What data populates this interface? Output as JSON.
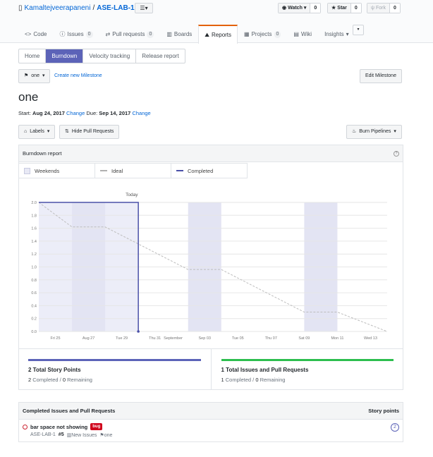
{
  "repo": {
    "owner": "Kamaltejveerapaneni",
    "sep": "/",
    "name": "ASE-LAB-1"
  },
  "social": {
    "watch": {
      "label": "Watch",
      "count": "0"
    },
    "star": {
      "label": "Star",
      "count": "0"
    },
    "fork": {
      "label": "Fork",
      "count": "0"
    }
  },
  "tabs": [
    {
      "label": "Code",
      "count": ""
    },
    {
      "label": "Issues",
      "count": "0"
    },
    {
      "label": "Pull requests",
      "count": "0"
    },
    {
      "label": "Boards",
      "count": ""
    },
    {
      "label": "Reports",
      "count": ""
    },
    {
      "label": "Projects",
      "count": "0"
    },
    {
      "label": "Wiki",
      "count": ""
    },
    {
      "label": "Insights",
      "count": ""
    }
  ],
  "subnav": [
    "Home",
    "Burndown",
    "Velocity tracking",
    "Release report"
  ],
  "milestone_select": "one",
  "create_milestone": "Create new Milestone",
  "edit_milestone": "Edit Milestone",
  "milestone": {
    "title": "one",
    "start_label": "Start:",
    "start": "Aug 24, 2017",
    "due_label": "Due:",
    "due": "Sep 14, 2017",
    "change": "Change"
  },
  "toolbar": {
    "labels": "Labels",
    "hide_prs": "Hide Pull Requests",
    "burn": "Burn Pipelines"
  },
  "report_title": "Burndown report",
  "legend": {
    "weekends": "Weekends",
    "ideal": "Ideal",
    "completed": "Completed"
  },
  "colors": {
    "accent": "#5c63b8",
    "completed_bar": "#5c63b8",
    "issues_bar": "#2cbe4e",
    "weekend": "#e8e9f5",
    "bug": "#d0021b"
  },
  "chart_data": {
    "type": "line",
    "x_tick_labels": [
      "Fri 25",
      "Aug 27",
      "Tue 29",
      "Thu 31",
      "September",
      "Sep 03",
      "Tue 05",
      "Thu 07",
      "Sat 09",
      "Mon 11",
      "Wed 13"
    ],
    "ylim": [
      0,
      2.0
    ],
    "y_ticks": [
      "0.0",
      "0.2",
      "0.4",
      "0.6",
      "0.8",
      "1.0",
      "1.2",
      "1.4",
      "1.6",
      "1.8",
      "2.0"
    ],
    "today_label": "Today",
    "series": [
      {
        "name": "Ideal",
        "x": [
          "Aug 24",
          "Aug 26",
          "Aug 28",
          "Sep 02",
          "Sep 04",
          "Sep 09",
          "Sep 11",
          "Sep 14"
        ],
        "y": [
          2.0,
          1.62,
          1.62,
          0.96,
          0.96,
          0.3,
          0.3,
          0.0
        ]
      },
      {
        "name": "Completed",
        "x": [
          "Aug 24",
          "Aug 30",
          "Aug 30"
        ],
        "y": [
          2.0,
          2.0,
          0.0
        ]
      }
    ]
  },
  "stats": {
    "story": {
      "title": "2 Total Story Points",
      "completed": "2",
      "completed_label": "Completed",
      "sep": "/",
      "remaining": "0",
      "remaining_label": "Remaining"
    },
    "issues": {
      "title": "1 Total Issues and Pull Requests",
      "completed": "1",
      "completed_label": "Completed",
      "sep": "/",
      "remaining": "0",
      "remaining_label": "Remaining"
    }
  },
  "completed_list": {
    "header": "Completed Issues and Pull Requests",
    "points_header": "Story points",
    "items": [
      {
        "title": "bar space not showing",
        "label": "bug",
        "repo": "ASE-LAB-1",
        "number": "#5",
        "pipeline": "New Issues",
        "milestone": "one",
        "points": "2"
      }
    ]
  }
}
